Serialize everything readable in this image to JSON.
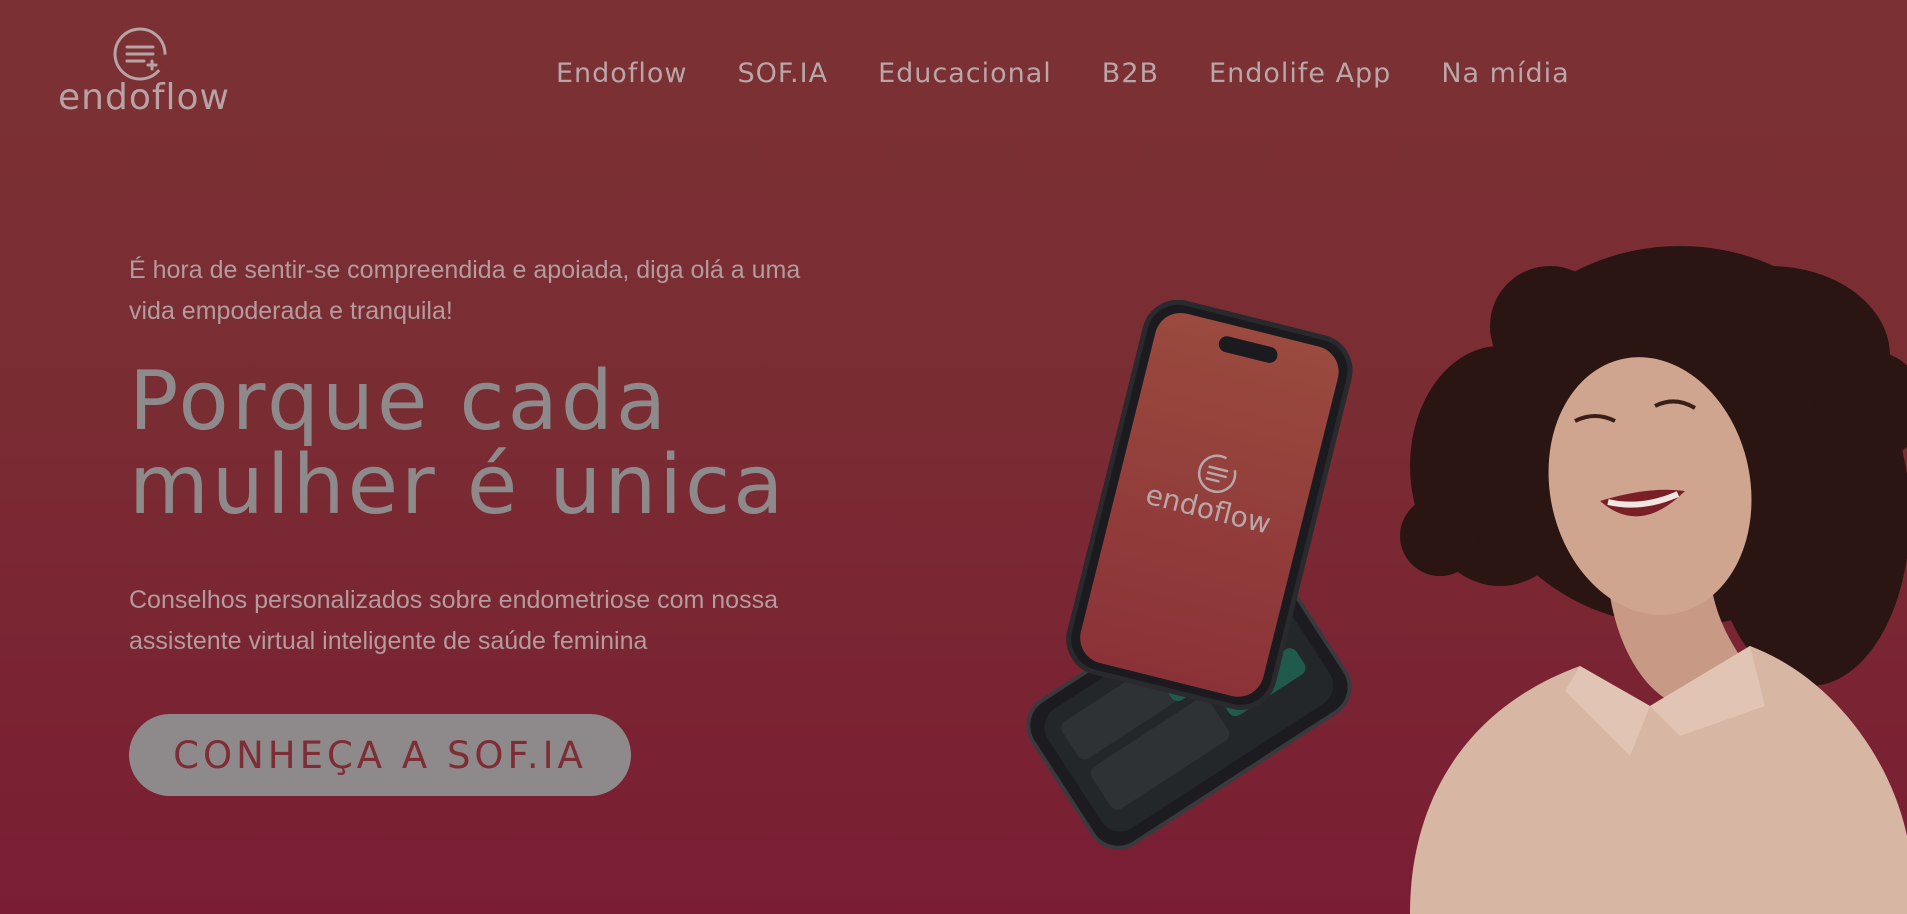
{
  "brand": {
    "name": "endoflow",
    "icon": "endoflow-logo-icon"
  },
  "nav": {
    "items": [
      {
        "label": "Endoflow"
      },
      {
        "label": "SOF.IA"
      },
      {
        "label": "Educacional"
      },
      {
        "label": "B2B"
      },
      {
        "label": "Endolife App"
      },
      {
        "label": "Na mídia"
      }
    ]
  },
  "hero": {
    "tagline": "É hora de sentir-se compreendida e apoiada, diga olá a uma vida empoderada e tranquila!",
    "headline_line1": "Porque cada",
    "headline_line2": "mulher é unica",
    "subcopy": "Conselhos personalizados sobre endometriose com nossa assistente virtual inteligente de saúde feminina",
    "cta_label": "CONHEÇA A SOF.IA"
  },
  "phone_mockup": {
    "screen_brand": "endoflow"
  },
  "colors": {
    "background_top": "#7b3133",
    "background_bottom": "#7a1d33",
    "text": "#b39b9e",
    "headline": "#8e8a8b",
    "cta_bg": "#8e8a8b"
  }
}
